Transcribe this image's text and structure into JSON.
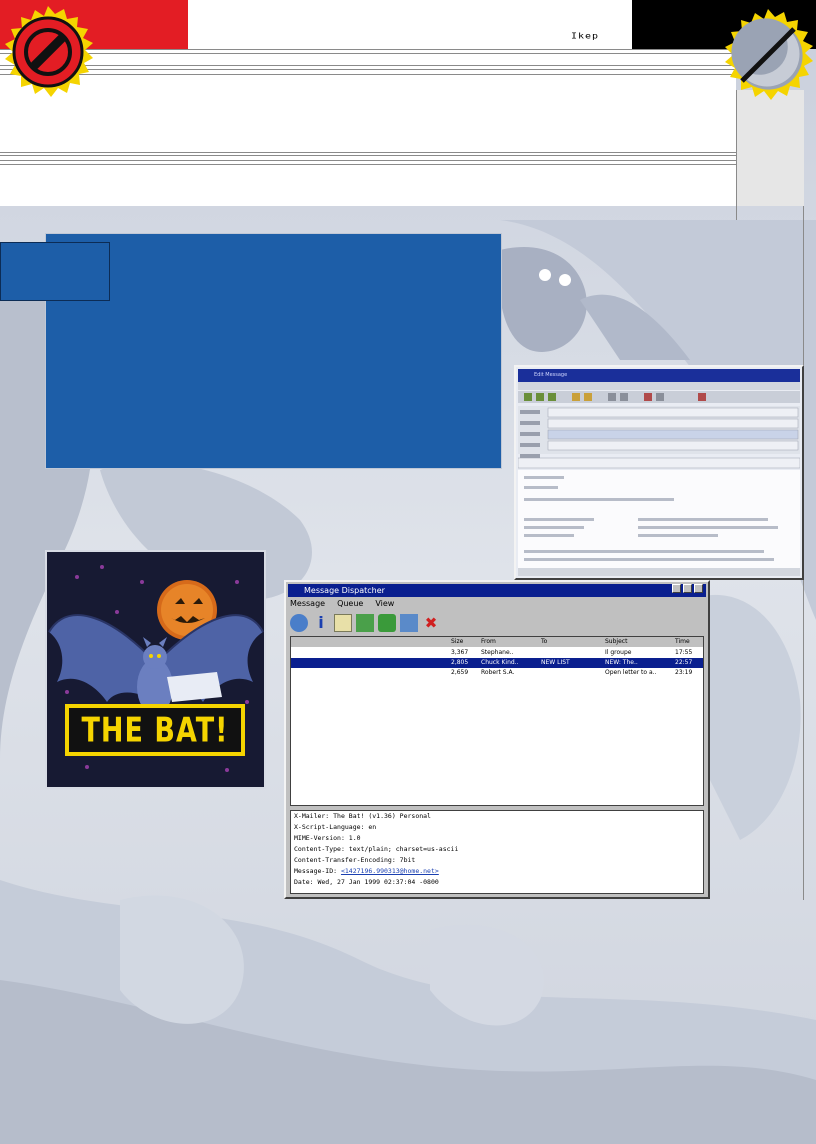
{
  "colors": {
    "accent_red": "#e31d24",
    "panel_blue": "#1d5ea8",
    "title_blue": "#0a1f8f",
    "badge_yellow": "#f5d400"
  },
  "icons": [
    "no-entry-icon",
    "half-circle-icon"
  ],
  "brand": {
    "mark": "Ikep"
  },
  "dispatcher": {
    "title": "Message Dispatcher",
    "menu": [
      "Message",
      "Queue",
      "View"
    ],
    "columns": [
      "Size",
      "From",
      "To",
      "Subject",
      "Time"
    ],
    "rows": [
      {
        "size": "3,367",
        "from": "Stephane..",
        "subject": "Il groupe",
        "time": "17:55"
      },
      {
        "size": "2,805",
        "from": "Chuck Kind..",
        "to": "NEW LIST",
        "subject": "NEW: The..",
        "time": "22:57"
      },
      {
        "size": "2,659",
        "from": "Robert S.A.",
        "subject": "Open letter to a..",
        "time": "23:19"
      }
    ],
    "headers": [
      "X-Mailer: The Bat! (v1.36) Personal",
      "X-Script-Language: en",
      "MIME-Version: 1.0",
      "Content-Type: text/plain; charset=us-ascii",
      "Content-Transfer-Encoding: 7bit",
      "Message-ID:",
      "Date: Wed, 27 Jan 1999 02:37:04 -0800"
    ],
    "message_id": "<1427196.990313@home.net>"
  },
  "editor": {
    "title": "Edit Message"
  },
  "cover": {
    "text": "THE BAT!"
  }
}
